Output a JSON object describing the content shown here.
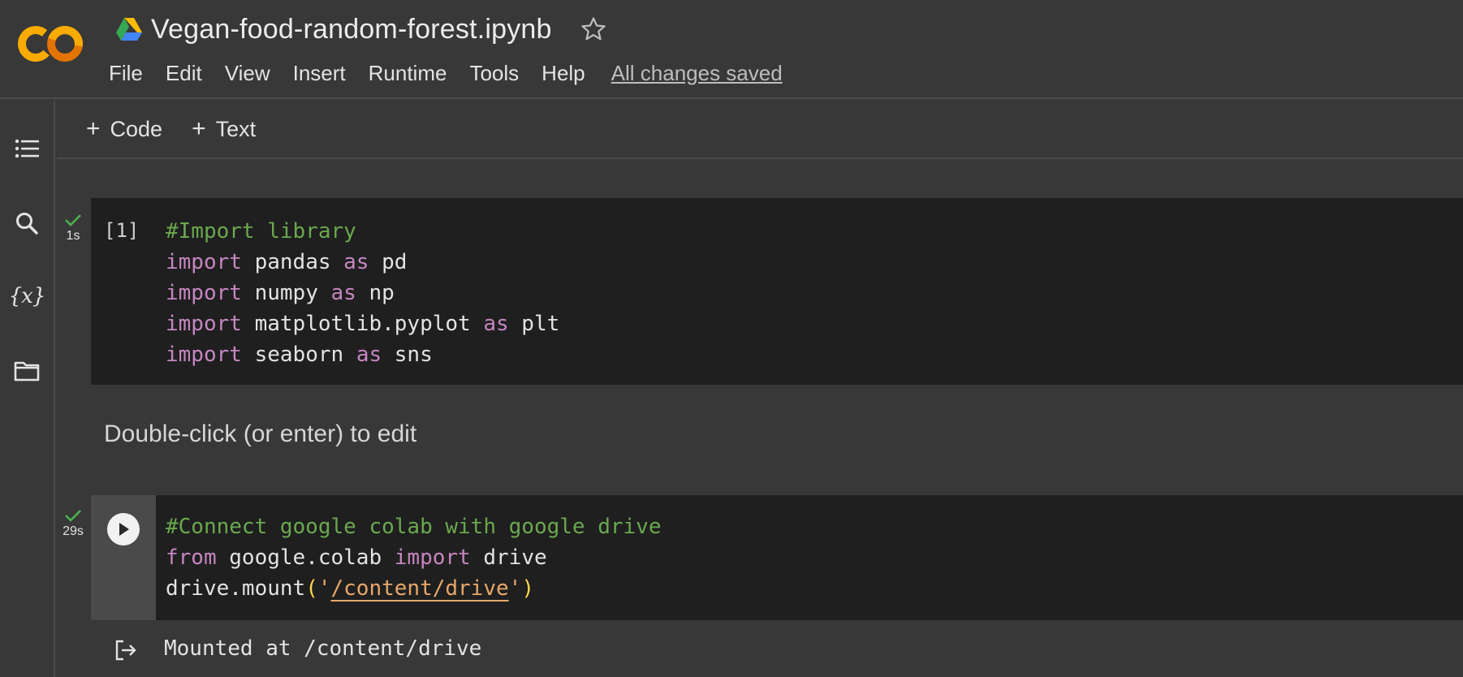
{
  "header": {
    "notebook_title": "Vegan-food-random-forest.ipynb",
    "menu": [
      "File",
      "Edit",
      "View",
      "Insert",
      "Runtime",
      "Tools",
      "Help"
    ],
    "save_status": "All changes saved"
  },
  "toolbar": {
    "add_code_label": "Code",
    "add_text_label": "Text"
  },
  "sidebar": {
    "icons": [
      "table-of-contents-icon",
      "search-icon",
      "variables-icon",
      "files-icon"
    ]
  },
  "cells": {
    "cell1": {
      "status": "success",
      "exec_time": "1s",
      "exec_count": "[1]",
      "lines": [
        [
          {
            "t": "#Import library",
            "c": "cm"
          }
        ],
        [
          {
            "t": "import",
            "c": "kw"
          },
          {
            "t": " pandas "
          },
          {
            "t": "as",
            "c": "kw"
          },
          {
            "t": " pd"
          }
        ],
        [
          {
            "t": "import",
            "c": "kw"
          },
          {
            "t": " numpy "
          },
          {
            "t": "as",
            "c": "kw"
          },
          {
            "t": " np"
          }
        ],
        [
          {
            "t": "import",
            "c": "kw"
          },
          {
            "t": " matplotlib.pyplot "
          },
          {
            "t": "as",
            "c": "kw"
          },
          {
            "t": " plt"
          }
        ],
        [
          {
            "t": "import",
            "c": "kw"
          },
          {
            "t": " seaborn "
          },
          {
            "t": "as",
            "c": "kw"
          },
          {
            "t": " sns"
          }
        ]
      ]
    },
    "text_cell": {
      "placeholder": "Double-click (or enter) to edit"
    },
    "cell2": {
      "status": "success",
      "exec_time": "29s",
      "lines": [
        [
          {
            "t": "#Connect google colab with google drive",
            "c": "cm"
          }
        ],
        [
          {
            "t": "from",
            "c": "kw"
          },
          {
            "t": " google.colab "
          },
          {
            "t": "import",
            "c": "kw"
          },
          {
            "t": " drive"
          }
        ],
        [
          {
            "t": "drive.mount"
          },
          {
            "t": "(",
            "c": "pu"
          },
          {
            "t": "'",
            "c": "st"
          },
          {
            "t": "/content/drive",
            "c": "st underline-str"
          },
          {
            "t": "'",
            "c": "st"
          },
          {
            "t": ")",
            "c": "pu"
          }
        ]
      ],
      "output": "Mounted at /content/drive"
    }
  },
  "colors": {
    "background": "#383838",
    "code_bg": "#1f1f1f",
    "comment": "#6aa84f",
    "keyword": "#c586c0",
    "string": "#e8a76a",
    "success_check": "#4caf50",
    "logo_orange": "#f9ab00",
    "logo_dark_orange": "#e37400"
  }
}
